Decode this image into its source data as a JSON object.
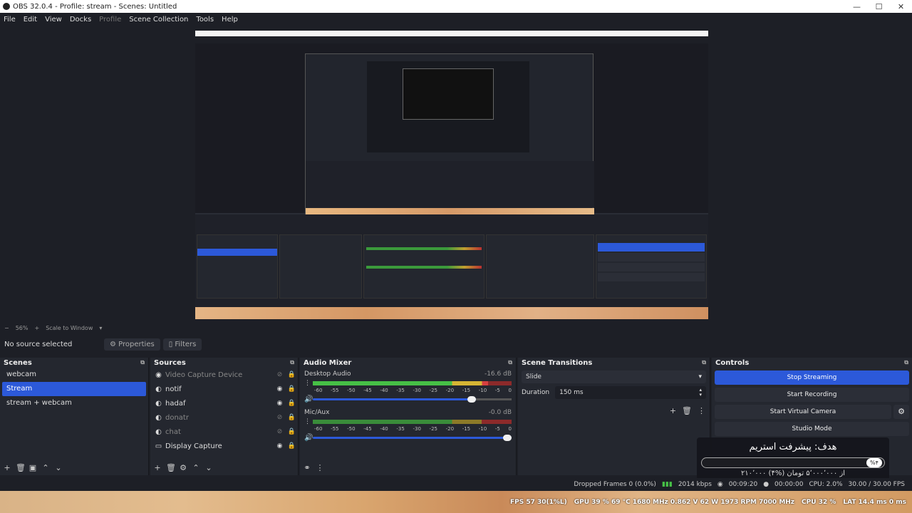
{
  "window": {
    "title": "OBS 32.0.4 - Profile: stream - Scenes: Untitled",
    "minimize": "—",
    "maximize": "☐",
    "close": "✕"
  },
  "menu": {
    "file": "File",
    "edit": "Edit",
    "view": "View",
    "docks": "Docks",
    "profile": "Profile",
    "scene_collection": "Scene Collection",
    "tools": "Tools",
    "help": "Help"
  },
  "zoombar": {
    "minus": "−",
    "zoom": "56%",
    "plus": "+",
    "mode": "Scale to Window",
    "caret": "▾"
  },
  "source_toolbar": {
    "no_source": "No source selected",
    "properties": "Properties",
    "filters": "Filters"
  },
  "scenes": {
    "title": "Scenes",
    "items": [
      "webcam",
      "Stream",
      "stream + webcam"
    ],
    "selected": 1
  },
  "sources": {
    "title": "Sources",
    "items": [
      {
        "label": "Video Capture Device",
        "icon": "◉",
        "dim": true
      },
      {
        "label": "notif",
        "icon": "◐",
        "dim": false
      },
      {
        "label": "hadaf",
        "icon": "◐",
        "dim": false
      },
      {
        "label": "donatr",
        "icon": "◐",
        "dim": true
      },
      {
        "label": "chat",
        "icon": "◐",
        "dim": true
      },
      {
        "label": "Display Capture",
        "icon": "▭",
        "dim": false
      }
    ]
  },
  "audio_mixer": {
    "title": "Audio Mixer",
    "tracks": [
      {
        "name": "Desktop Audio",
        "db": "-16.6 dB",
        "level": 0.88,
        "volume": 0.82
      },
      {
        "name": "Mic/Aux",
        "db": "-0.0 dB",
        "level": 0.0,
        "volume": 1.0
      }
    ],
    "ticks": [
      "-60",
      "-55",
      "-50",
      "-45",
      "-40",
      "-35",
      "-30",
      "-25",
      "-20",
      "-15",
      "-10",
      "-5",
      "0"
    ]
  },
  "scene_transitions": {
    "title": "Scene Transitions",
    "transition": "Slide",
    "duration_label": "Duration",
    "duration": "150 ms"
  },
  "controls": {
    "title": "Controls",
    "stop_streaming": "Stop Streaming",
    "start_recording": "Start Recording",
    "start_virtual_camera": "Start Virtual Camera",
    "studio_mode": "Studio Mode"
  },
  "goal_overlay": {
    "title": "هدف: پیشرفت استریم",
    "percent": "%۴",
    "amount": "۲۱۰٬۰۰۰ از ۵٬۰۰۰٬۰۰۰ تومان (%۴)"
  },
  "statusbar": {
    "dropped": "Dropped Frames 0 (0.0%)",
    "bitrate": "2014 kbps",
    "stream_time": "00:09:20",
    "rec_time": "00:00:00",
    "cpu": "CPU: 2.0%",
    "fps": "30.00 / 30.00 FPS"
  },
  "overlay_stats": {
    "fps": "FPS  57  30(1%L)",
    "gpu": "GPU 39 % 69 °C 1680 MHz 0.862 V 62 W 1973 RPM 7000 MHz",
    "cpu": "CPU 32 %",
    "lat": "LAT 14.4 ms 0 ms"
  }
}
